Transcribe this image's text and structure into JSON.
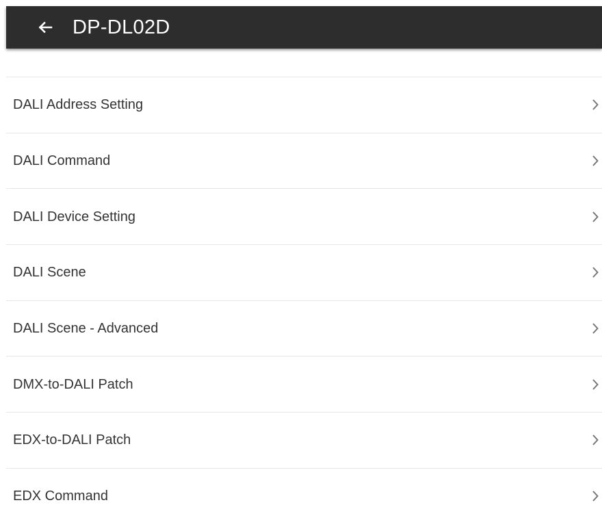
{
  "header": {
    "title": "DP-DL02D",
    "back_icon": "arrow-left-icon"
  },
  "menu": {
    "items": [
      {
        "label": "DALI Address Setting",
        "icon": "chevron-right-icon"
      },
      {
        "label": "DALI Command",
        "icon": "chevron-right-icon"
      },
      {
        "label": "DALI Device Setting",
        "icon": "chevron-right-icon"
      },
      {
        "label": "DALI Scene",
        "icon": "chevron-right-icon"
      },
      {
        "label": "DALI Scene - Advanced",
        "icon": "chevron-right-icon"
      },
      {
        "label": "DMX-to-DALI Patch",
        "icon": "chevron-right-icon"
      },
      {
        "label": "EDX-to-DALI Patch",
        "icon": "chevron-right-icon"
      },
      {
        "label": "EDX Command",
        "icon": "chevron-right-icon"
      }
    ]
  },
  "colors": {
    "app_bar": "#2d2d2d",
    "app_bar_text": "#ffffff",
    "item_text": "#333333",
    "divider": "#e6e6e6",
    "chevron": "#777777"
  }
}
